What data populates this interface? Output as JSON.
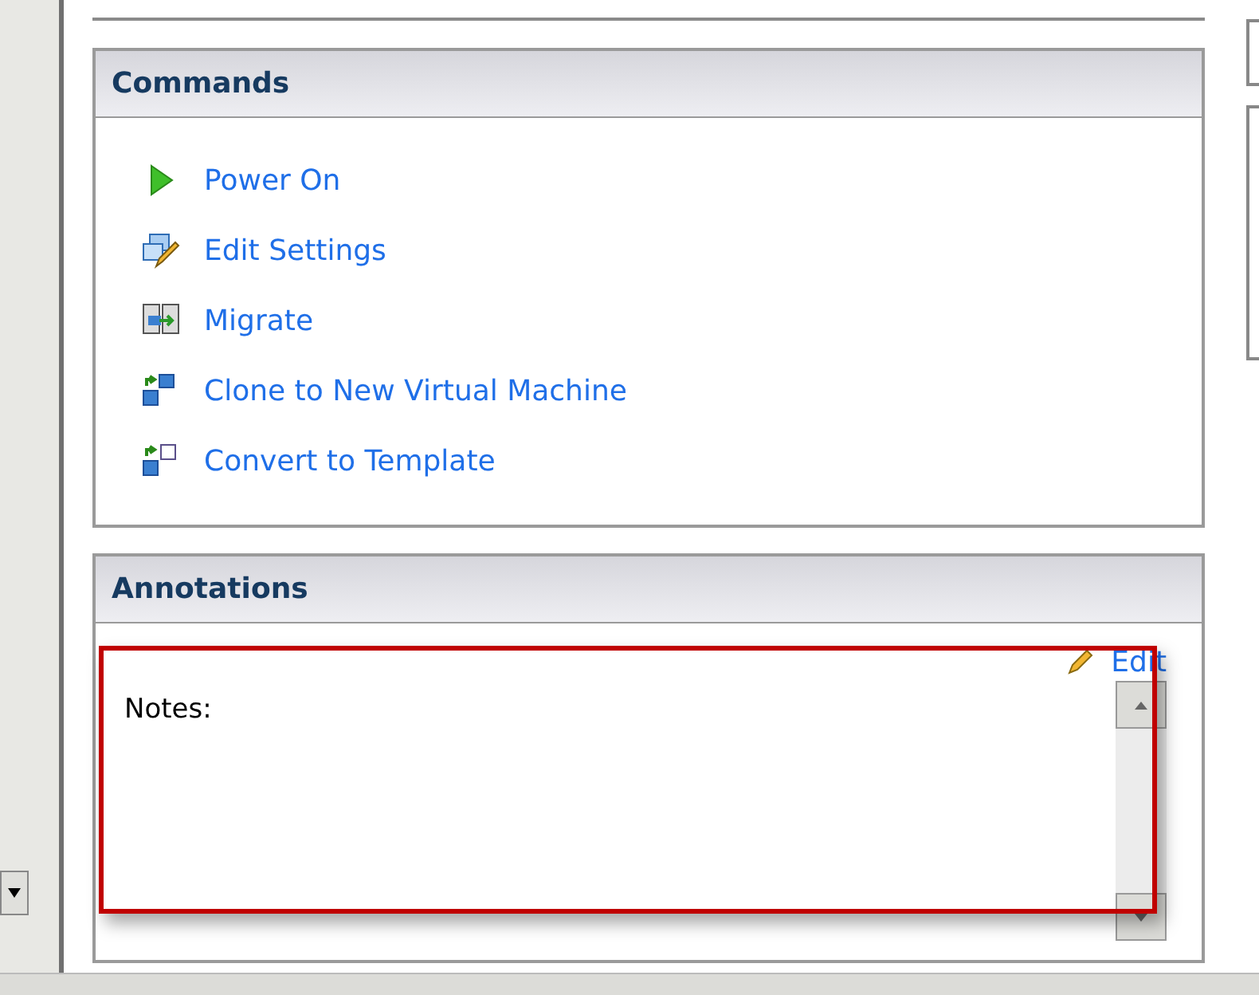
{
  "commands": {
    "title": "Commands",
    "items": [
      {
        "kind": "power",
        "label": "Power On"
      },
      {
        "kind": "settings",
        "label": "Edit Settings"
      },
      {
        "kind": "migrate",
        "label": "Migrate"
      },
      {
        "kind": "clone",
        "label": "Clone to New Virtual Machine"
      },
      {
        "kind": "template",
        "label": "Convert to Template"
      }
    ]
  },
  "annotations": {
    "title": "Annotations",
    "edit_link": "Edit",
    "notes_label": "Notes:",
    "highlighted": true
  }
}
